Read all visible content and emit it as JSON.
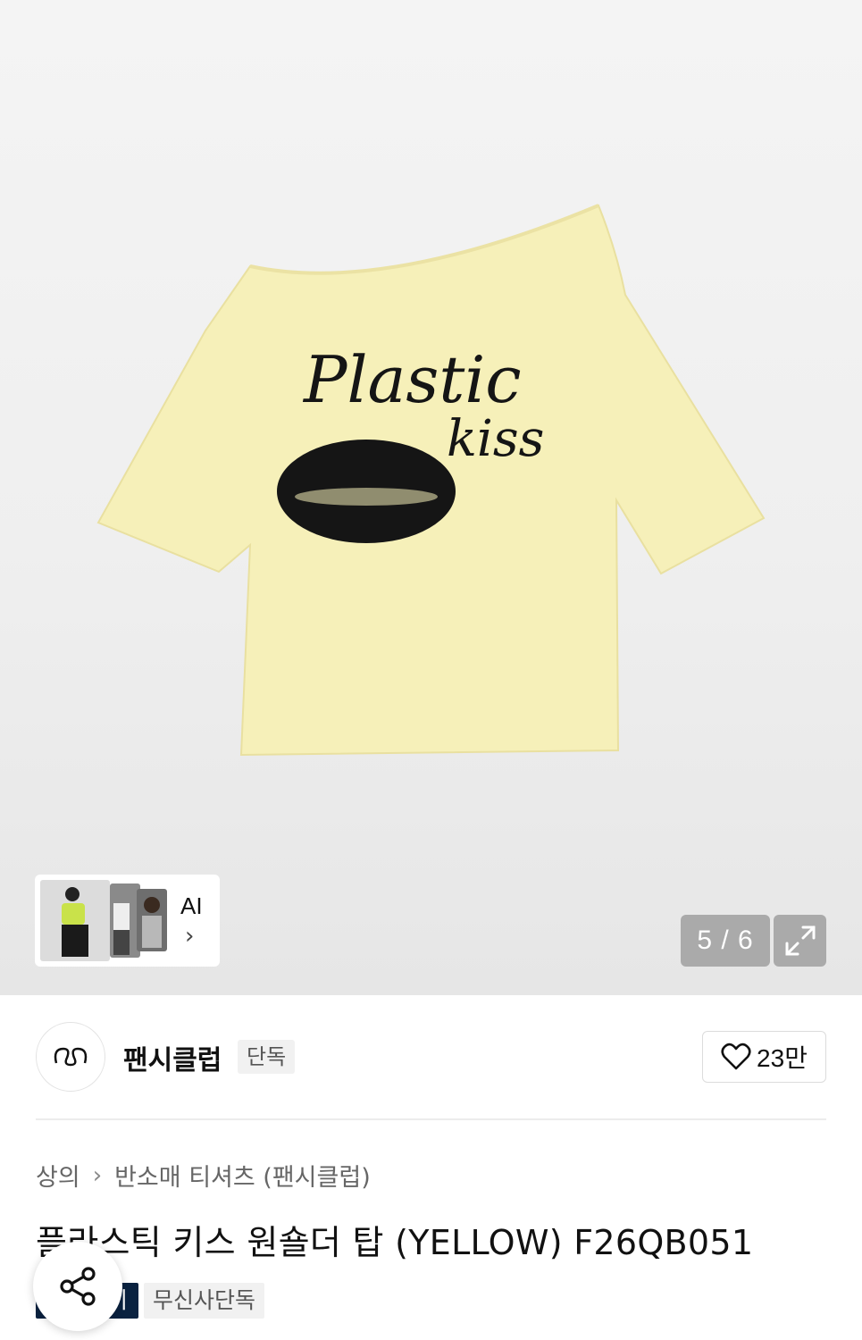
{
  "gallery": {
    "counter": "5 / 6",
    "ai_label": "AI",
    "print_line1": "Plastic",
    "print_line2": "kiss"
  },
  "brand": {
    "name": "팬시클럽",
    "tag": "단독",
    "like_count": "23만"
  },
  "breadcrumb": {
    "items": [
      "상의",
      "반소매 티셔츠 (팬시클럽)"
    ]
  },
  "product": {
    "title": "플라스틱 키스 원숄더 탑 (YELLOW) F26QB051",
    "badges": [
      "이",
      "무신사단독"
    ]
  },
  "colors": {
    "shirt": "#f6f0b9",
    "badge_dark": "#0a2240"
  }
}
